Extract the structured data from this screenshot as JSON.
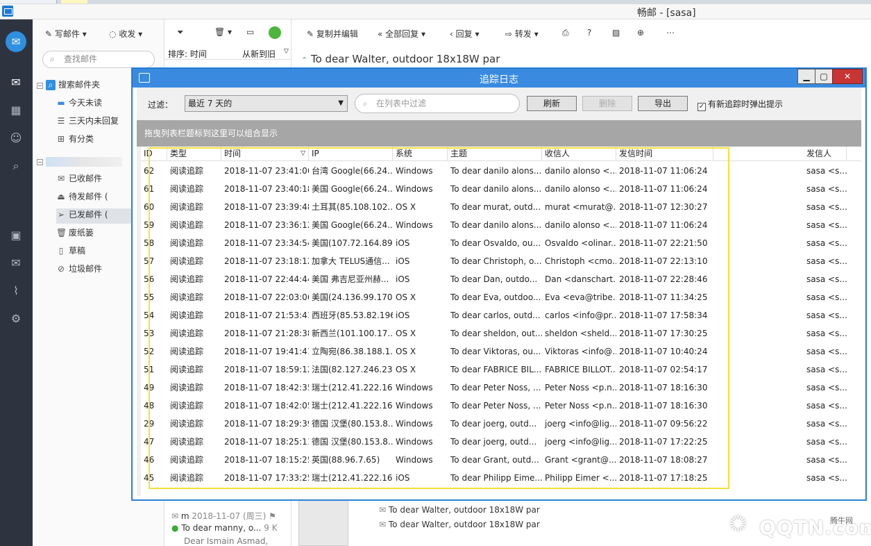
{
  "app": {
    "title": "畅邮 - [sasa]"
  },
  "toolbar": {
    "compose": "写邮件",
    "receive": "收发",
    "search_placeholder": "查找邮件",
    "sort_label": "排序: 时间",
    "sort_order": "从新到旧"
  },
  "reading_toolbar": {
    "copy_edit": "复制并编辑",
    "reply_all": "全部回复",
    "reply": "回复",
    "forward": "转发"
  },
  "reading": {
    "subject": "To dear Walter, outdoor 18x18W par",
    "thread": [
      "To dear Walter, outdoor 18x18W par",
      "To dear Walter, outdoor 18x18W par"
    ]
  },
  "folders": {
    "search_folder": "搜索邮件夹",
    "saved": [
      "今天未读",
      "三天内未回复",
      "有分类"
    ],
    "mailbox": [
      "已收邮件",
      "待发邮件 (",
      "已发邮件 (",
      "废纸篓",
      "草稿",
      "垃圾邮件"
    ]
  },
  "bottom_list": {
    "sender": "m",
    "date": "2018-11-07 (周三)",
    "subject": "To dear manny, o...",
    "size": "9 K",
    "preview": "Dear Ismain Asmad,"
  },
  "dialog": {
    "title": "追踪日志",
    "filter_label": "过滤：",
    "filter_value": "最近 7 天的",
    "search_placeholder": "在列表中过滤",
    "refresh": "刷新",
    "delete": "删除",
    "export": "导出",
    "notify_label": "有新追踪时弹出提示",
    "group_hint": "拖曳列表栏题标到这里可以组合显示",
    "columns": [
      "ID",
      "类型",
      "时间",
      "IP",
      "系统",
      "主题",
      "收信人",
      "发信时间",
      "发信人"
    ],
    "rows": [
      [
        "62",
        "阅读追踪",
        "2018-11-07 23:41:06",
        "台湾 Google(66.24...",
        "Windows",
        "To dear danilo alons...",
        "danilo alonso <...",
        "2018-11-07 11:06:24",
        "sasa <s..."
      ],
      [
        "61",
        "阅读追踪",
        "2018-11-07 23:40:18",
        "美国 Google(66.24...",
        "Windows",
        "To dear danilo alons...",
        "danilo alonso <...",
        "2018-11-07 11:06:24",
        "sasa <s..."
      ],
      [
        "60",
        "阅读追踪",
        "2018-11-07 23:39:48",
        "土耳其(85.108.102....",
        "OS X",
        "To dear murat, outd...",
        "murat <murat@...",
        "2018-11-07 12:30:27",
        "sasa <s..."
      ],
      [
        "59",
        "阅读追踪",
        "2018-11-07 23:36:12",
        "美国 Google(66.24...",
        "Windows",
        "To dear danilo alons...",
        "danilo alonso <...",
        "2018-11-07 11:06:24",
        "sasa <s..."
      ],
      [
        "58",
        "阅读追踪",
        "2018-11-07 23:34:54",
        "美国(107.72.164.89)",
        "iOS",
        "To dear Osvaldo, ou...",
        "Osvaldo <olinar...",
        "2018-11-07 22:21:50",
        "sasa <s..."
      ],
      [
        "57",
        "阅读追踪",
        "2018-11-07 23:18:12",
        "加拿大 TELUS通信...",
        "iOS",
        "To dear Christoph, o...",
        "Christoph <cmo...",
        "2018-11-07 22:13:10",
        "sasa <s..."
      ],
      [
        "56",
        "阅读追踪",
        "2018-11-07 22:44:44",
        "美国 弗吉尼亚州赫...",
        "iOS",
        "To dear Dan, outdo...",
        "Dan <danschart...",
        "2018-11-07 22:28:46",
        "sasa <s..."
      ],
      [
        "55",
        "阅读追踪",
        "2018-11-07 22:03:06",
        "美国(24.136.99.170)",
        "OS X",
        "To dear Eva, outdoo...",
        "Eva <eva@tribe...",
        "2018-11-07 11:34:25",
        "sasa <s..."
      ],
      [
        "54",
        "阅读追踪",
        "2018-11-07 21:53:41",
        "西班牙(85.53.82.196)",
        "iOS",
        "To dear carlos, outd...",
        "carlos <info@pr...",
        "2018-11-07 17:58:34",
        "sasa <s..."
      ],
      [
        "53",
        "阅读追踪",
        "2018-11-07 21:28:38",
        "新西兰(101.100.17...",
        "OS X",
        "To dear sheldon, out...",
        "sheldon <sheld...",
        "2018-11-07 17:30:25",
        "sasa <s..."
      ],
      [
        "52",
        "阅读追踪",
        "2018-11-07 19:41:41",
        "立陶宛(86.38.188.1...",
        "OS X",
        "To dear Viktoras, ou...",
        "Viktoras <info@...",
        "2018-11-07 10:40:24",
        "sasa <s..."
      ],
      [
        "51",
        "阅读追踪",
        "2018-11-07 18:59:12",
        "法国(82.127.246.23...",
        "OS X",
        "To dear FABRICE BIL...",
        "FABRICE BILLOT...",
        "2018-11-07 02:54:17",
        "sasa <s..."
      ],
      [
        "49",
        "阅读追踪",
        "2018-11-07 18:42:35",
        "瑞士(212.41.222.16...",
        "Windows",
        "To dear Peter Noss, ...",
        "Peter Noss <p.n...",
        "2018-11-07 18:16:30",
        "sasa <s..."
      ],
      [
        "48",
        "阅读追踪",
        "2018-11-07 18:42:05",
        "瑞士(212.41.222.16...",
        "Windows",
        "To dear Peter Noss, ...",
        "Peter Noss <p.n...",
        "2018-11-07 18:16:30",
        "sasa <s..."
      ],
      [
        "29",
        "阅读追踪",
        "2018-11-07 18:29:39",
        "德国 汉堡(80.153.8...",
        "Windows",
        "To dear joerg, outd...",
        "joerg <info@lig...",
        "2018-11-07 09:56:22",
        "sasa <s..."
      ],
      [
        "47",
        "阅读追踪",
        "2018-11-07 18:25:11",
        "德国 汉堡(80.153.8...",
        "Windows",
        "To dear joerg, outd...",
        "joerg <info@lig...",
        "2018-11-07 17:22:25",
        "sasa <s..."
      ],
      [
        "46",
        "阅读追踪",
        "2018-11-07 18:15:25",
        "英国(88.96.7.65)",
        "Windows",
        "To dear Grant, outd...",
        "Grant <grant@...",
        "2018-11-07 18:08:27",
        "sasa <s..."
      ],
      [
        "45",
        "阅读追踪",
        "2018-11-07 17:33:25",
        "瑞士(212.41.222.16...",
        "iOS",
        "To dear Philipp Eime...",
        "Philipp Eimer <...",
        "2018-11-07 17:18:25",
        "sasa <s..."
      ]
    ]
  },
  "watermark": {
    "brand": "腾牛网",
    "logo_text": "QQTN.com"
  },
  "colors": {
    "accent": "#3a8be0",
    "rail": "#2d3440",
    "highlight": "#f3e13a"
  }
}
